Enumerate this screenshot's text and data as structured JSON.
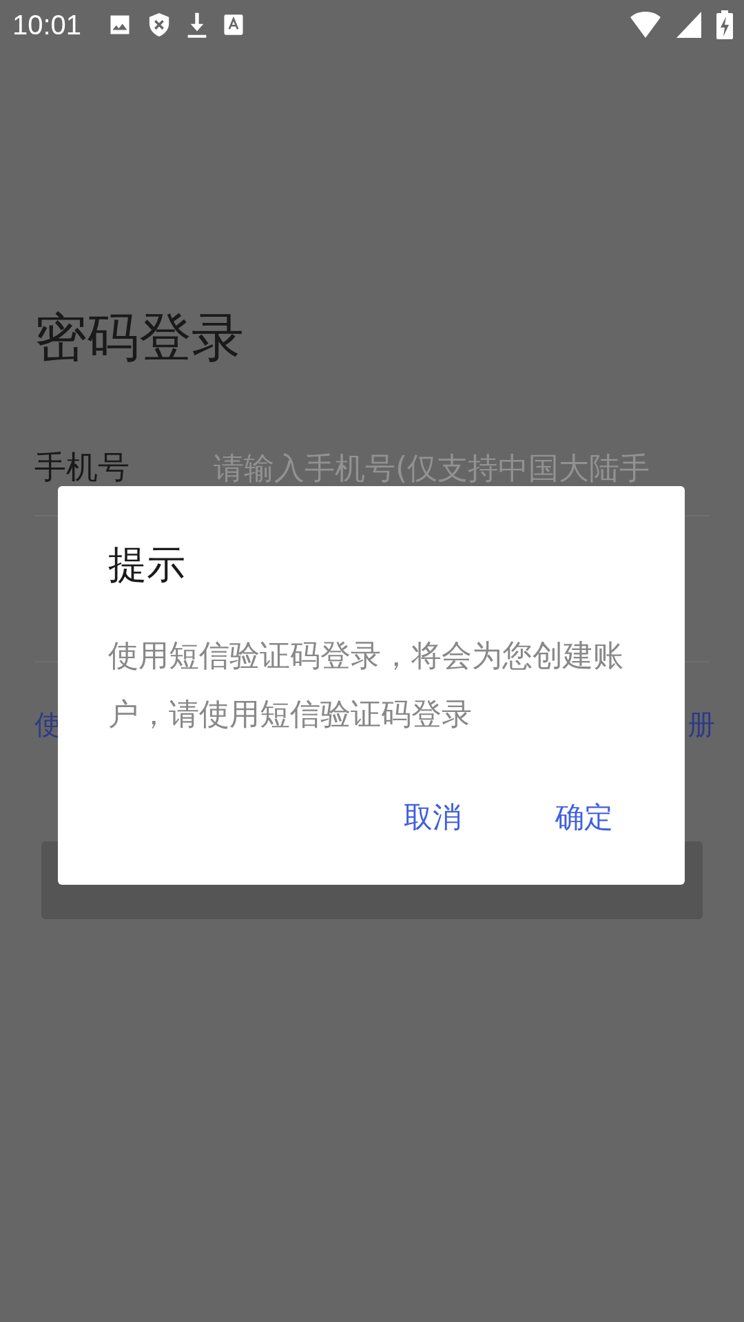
{
  "status_bar": {
    "time": "10:01"
  },
  "page": {
    "title": "密码登录",
    "phone_row": {
      "label": "手机号",
      "placeholder": "请输入手机号(仅支持中国大陆手"
    },
    "links": {
      "left": "使",
      "right": "册"
    }
  },
  "dialog": {
    "title": "提示",
    "message": "使用短信验证码登录，将会为您创建账户，请使用短信验证码登录",
    "buttons": [
      "取消",
      "确定"
    ]
  }
}
